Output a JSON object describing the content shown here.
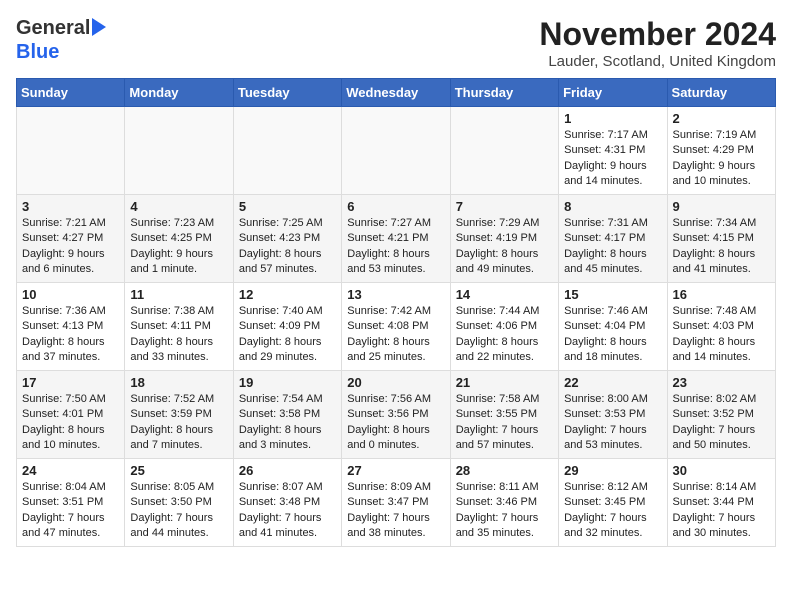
{
  "header": {
    "logo_general": "General",
    "logo_blue": "Blue",
    "month_title": "November 2024",
    "location": "Lauder, Scotland, United Kingdom"
  },
  "days_of_week": [
    "Sunday",
    "Monday",
    "Tuesday",
    "Wednesday",
    "Thursday",
    "Friday",
    "Saturday"
  ],
  "weeks": [
    [
      {
        "day": "",
        "info": ""
      },
      {
        "day": "",
        "info": ""
      },
      {
        "day": "",
        "info": ""
      },
      {
        "day": "",
        "info": ""
      },
      {
        "day": "",
        "info": ""
      },
      {
        "day": "1",
        "info": "Sunrise: 7:17 AM\nSunset: 4:31 PM\nDaylight: 9 hours and 14 minutes."
      },
      {
        "day": "2",
        "info": "Sunrise: 7:19 AM\nSunset: 4:29 PM\nDaylight: 9 hours and 10 minutes."
      }
    ],
    [
      {
        "day": "3",
        "info": "Sunrise: 7:21 AM\nSunset: 4:27 PM\nDaylight: 9 hours and 6 minutes."
      },
      {
        "day": "4",
        "info": "Sunrise: 7:23 AM\nSunset: 4:25 PM\nDaylight: 9 hours and 1 minute."
      },
      {
        "day": "5",
        "info": "Sunrise: 7:25 AM\nSunset: 4:23 PM\nDaylight: 8 hours and 57 minutes."
      },
      {
        "day": "6",
        "info": "Sunrise: 7:27 AM\nSunset: 4:21 PM\nDaylight: 8 hours and 53 minutes."
      },
      {
        "day": "7",
        "info": "Sunrise: 7:29 AM\nSunset: 4:19 PM\nDaylight: 8 hours and 49 minutes."
      },
      {
        "day": "8",
        "info": "Sunrise: 7:31 AM\nSunset: 4:17 PM\nDaylight: 8 hours and 45 minutes."
      },
      {
        "day": "9",
        "info": "Sunrise: 7:34 AM\nSunset: 4:15 PM\nDaylight: 8 hours and 41 minutes."
      }
    ],
    [
      {
        "day": "10",
        "info": "Sunrise: 7:36 AM\nSunset: 4:13 PM\nDaylight: 8 hours and 37 minutes."
      },
      {
        "day": "11",
        "info": "Sunrise: 7:38 AM\nSunset: 4:11 PM\nDaylight: 8 hours and 33 minutes."
      },
      {
        "day": "12",
        "info": "Sunrise: 7:40 AM\nSunset: 4:09 PM\nDaylight: 8 hours and 29 minutes."
      },
      {
        "day": "13",
        "info": "Sunrise: 7:42 AM\nSunset: 4:08 PM\nDaylight: 8 hours and 25 minutes."
      },
      {
        "day": "14",
        "info": "Sunrise: 7:44 AM\nSunset: 4:06 PM\nDaylight: 8 hours and 22 minutes."
      },
      {
        "day": "15",
        "info": "Sunrise: 7:46 AM\nSunset: 4:04 PM\nDaylight: 8 hours and 18 minutes."
      },
      {
        "day": "16",
        "info": "Sunrise: 7:48 AM\nSunset: 4:03 PM\nDaylight: 8 hours and 14 minutes."
      }
    ],
    [
      {
        "day": "17",
        "info": "Sunrise: 7:50 AM\nSunset: 4:01 PM\nDaylight: 8 hours and 10 minutes."
      },
      {
        "day": "18",
        "info": "Sunrise: 7:52 AM\nSunset: 3:59 PM\nDaylight: 8 hours and 7 minutes."
      },
      {
        "day": "19",
        "info": "Sunrise: 7:54 AM\nSunset: 3:58 PM\nDaylight: 8 hours and 3 minutes."
      },
      {
        "day": "20",
        "info": "Sunrise: 7:56 AM\nSunset: 3:56 PM\nDaylight: 8 hours and 0 minutes."
      },
      {
        "day": "21",
        "info": "Sunrise: 7:58 AM\nSunset: 3:55 PM\nDaylight: 7 hours and 57 minutes."
      },
      {
        "day": "22",
        "info": "Sunrise: 8:00 AM\nSunset: 3:53 PM\nDaylight: 7 hours and 53 minutes."
      },
      {
        "day": "23",
        "info": "Sunrise: 8:02 AM\nSunset: 3:52 PM\nDaylight: 7 hours and 50 minutes."
      }
    ],
    [
      {
        "day": "24",
        "info": "Sunrise: 8:04 AM\nSunset: 3:51 PM\nDaylight: 7 hours and 47 minutes."
      },
      {
        "day": "25",
        "info": "Sunrise: 8:05 AM\nSunset: 3:50 PM\nDaylight: 7 hours and 44 minutes."
      },
      {
        "day": "26",
        "info": "Sunrise: 8:07 AM\nSunset: 3:48 PM\nDaylight: 7 hours and 41 minutes."
      },
      {
        "day": "27",
        "info": "Sunrise: 8:09 AM\nSunset: 3:47 PM\nDaylight: 7 hours and 38 minutes."
      },
      {
        "day": "28",
        "info": "Sunrise: 8:11 AM\nSunset: 3:46 PM\nDaylight: 7 hours and 35 minutes."
      },
      {
        "day": "29",
        "info": "Sunrise: 8:12 AM\nSunset: 3:45 PM\nDaylight: 7 hours and 32 minutes."
      },
      {
        "day": "30",
        "info": "Sunrise: 8:14 AM\nSunset: 3:44 PM\nDaylight: 7 hours and 30 minutes."
      }
    ]
  ]
}
